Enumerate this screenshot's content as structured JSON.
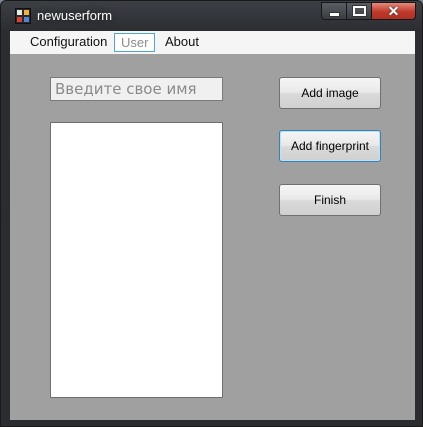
{
  "window": {
    "title": "newuserform"
  },
  "caption_buttons": {
    "minimize_icon": "minimize-icon",
    "maximize_icon": "maximize-icon",
    "close_icon": "close-icon",
    "close_glyph": "✕"
  },
  "menu": {
    "items": [
      {
        "label": "Configuration"
      },
      {
        "label": "User"
      },
      {
        "label": "About"
      }
    ]
  },
  "form": {
    "name_placeholder": "Введите свое имя",
    "name_value": ""
  },
  "buttons": {
    "add_image": "Add image",
    "add_fingerprint": "Add fingerprint",
    "finish": "Finish"
  },
  "colors": {
    "client_background": "#a0a0a0",
    "menu_selected_border": "#4fa7d8",
    "close_button": "#c0392b"
  }
}
